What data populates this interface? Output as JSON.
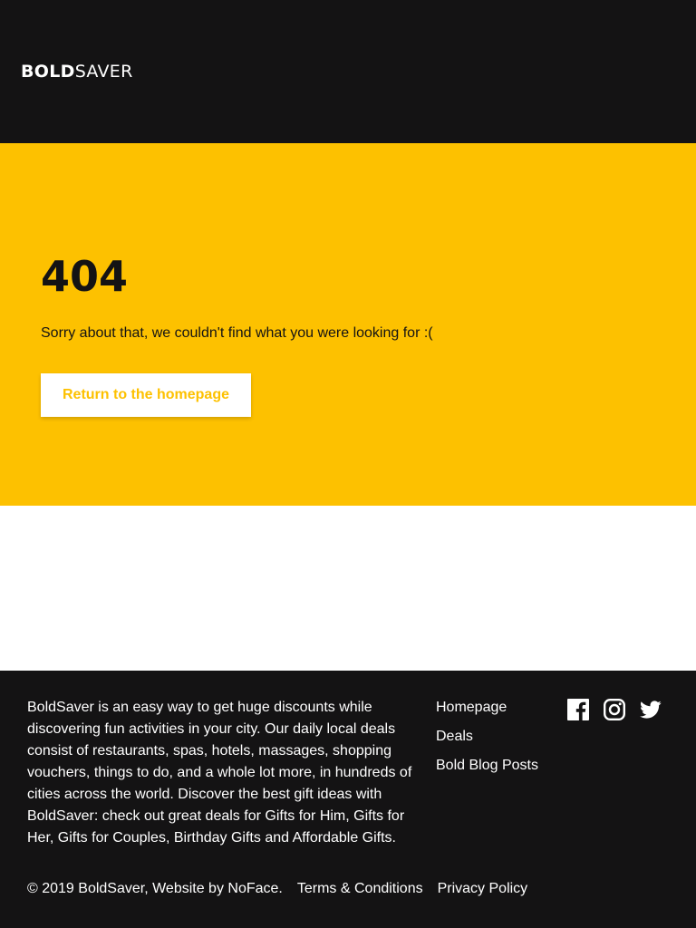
{
  "header": {
    "logo_bold": "BOLD",
    "logo_light": "SAVER"
  },
  "error": {
    "code": "404",
    "message": "Sorry about that, we couldn't find what you were looking for :(",
    "button_label": "Return to the homepage"
  },
  "footer": {
    "about": "BoldSaver is an easy way to get huge discounts while discovering fun activities in your city. Our daily local deals consist of restaurants, spas, hotels, massages, shopping vouchers, things to do, and a whole lot more, in hundreds of cities across the world. Discover the best gift ideas with BoldSaver: check out great deals for Gifts for Him, Gifts for Her, Gifts for Couples, Birthday Gifts and Affordable Gifts.",
    "nav": [
      "Homepage",
      "Deals",
      "Bold Blog Posts"
    ],
    "social": [
      "facebook-icon",
      "instagram-icon",
      "twitter-icon"
    ],
    "copyright": "© 2019 BoldSaver, Website by NoFace.",
    "terms": "Terms & Conditions",
    "privacy": "Privacy Policy"
  },
  "colors": {
    "dark": "#141314",
    "accent": "#fdc100",
    "white": "#ffffff"
  }
}
